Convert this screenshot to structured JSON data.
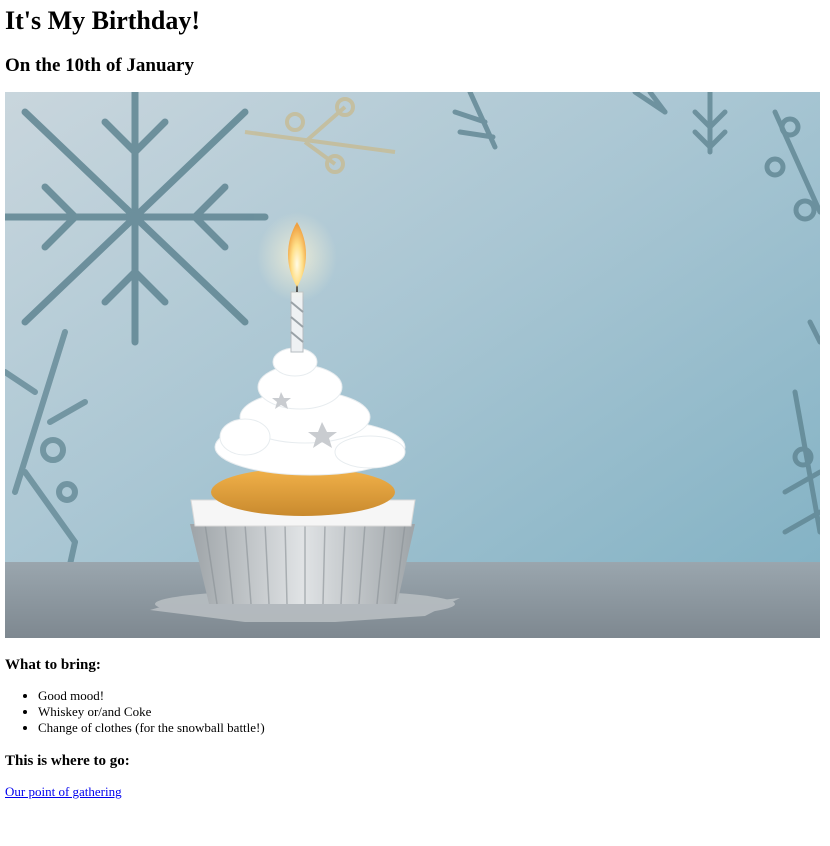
{
  "page": {
    "title": "It's My Birthday!",
    "subtitle": "On the 10th of January"
  },
  "hero_image": {
    "alt": "",
    "description_icon": "cupcake-with-candle-image"
  },
  "bring": {
    "heading": "What to bring:",
    "items": [
      "Good mood!",
      "Whiskey or/and Coke",
      "Change of clothes (for the snowball battle!)"
    ]
  },
  "location": {
    "heading": "This is where to go:",
    "link_text": "Our point of gathering"
  },
  "colors": {
    "link": "#0000ee",
    "background_blue": "#8fb5c6",
    "frosting": "#ffffff",
    "cake": "#e0a040"
  }
}
